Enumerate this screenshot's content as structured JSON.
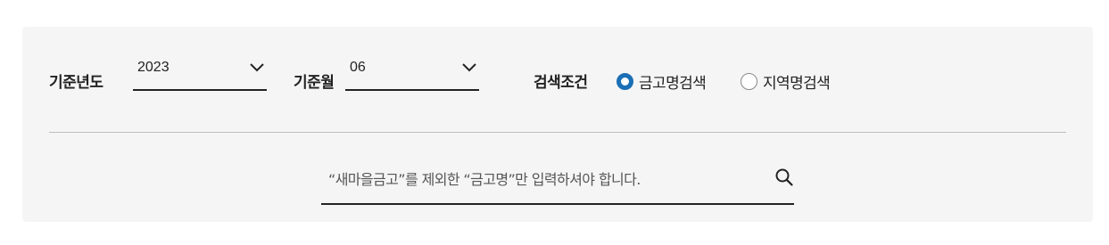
{
  "filters": {
    "year_label": "기준년도",
    "year_value": "2023",
    "month_label": "기준월",
    "month_value": "06",
    "condition_label": "검색조건",
    "options": [
      {
        "label": "금고명검색",
        "checked": true
      },
      {
        "label": "지역명검색",
        "checked": false
      }
    ]
  },
  "search": {
    "placeholder": "“새마을금고”를 제외한 “금고명”만 입력하셔야 합니다.",
    "icon": "search-icon"
  },
  "colors": {
    "panel_bg": "#f5f5f5",
    "accent": "#1a6fb5",
    "underline": "#222222",
    "divider": "#bdbdbd"
  }
}
